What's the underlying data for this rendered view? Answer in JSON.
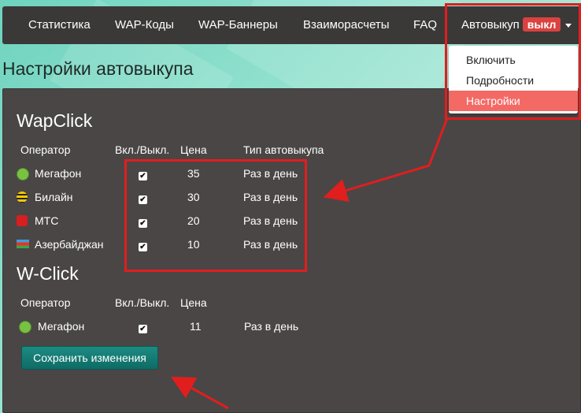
{
  "nav": {
    "items": [
      "Статистика",
      "WAP-Коды",
      "WAP-Баннеры",
      "Взаиморасчеты",
      "FAQ"
    ],
    "autobuy_label": "Автовыкуп",
    "autobuy_status": "выкл"
  },
  "dropdown": {
    "items": [
      "Включить",
      "Подробности",
      "Настройки"
    ],
    "active": "Настройки"
  },
  "page_title": "Настройки автовыкупа",
  "wapclick": {
    "title": "WapClick",
    "headers": [
      "Оператор",
      "Вкл./Выкл.",
      "Цена",
      "Тип автовыкупа"
    ],
    "rows": [
      {
        "operator": "Мегафон",
        "enabled": true,
        "price": "35",
        "type": "Раз в день"
      },
      {
        "operator": "Билайн",
        "enabled": true,
        "price": "30",
        "type": "Раз в день"
      },
      {
        "operator": "МТС",
        "enabled": true,
        "price": "20",
        "type": "Раз в день"
      },
      {
        "operator": "Азербайджан",
        "enabled": true,
        "price": "10",
        "type": "Раз в день"
      }
    ]
  },
  "wclick": {
    "title": "W-Click",
    "headers": [
      "Оператор",
      "Вкл./Выкл.",
      "Цена"
    ],
    "rows": [
      {
        "operator": "Мегафон",
        "enabled": true,
        "price": "11",
        "type": "Раз в день"
      }
    ]
  },
  "save_label": "Сохранить изменения",
  "colors": {
    "accent": "#0e6b65",
    "badge": "#d9423f",
    "highlight": "#e01e1e",
    "dropdown_active": "#f36a65"
  },
  "icons": {
    "megafon": "megafon-icon",
    "beeline": "beeline-icon",
    "mts": "mts-icon",
    "azerbaijan": "azerbaijan-flag-icon"
  }
}
